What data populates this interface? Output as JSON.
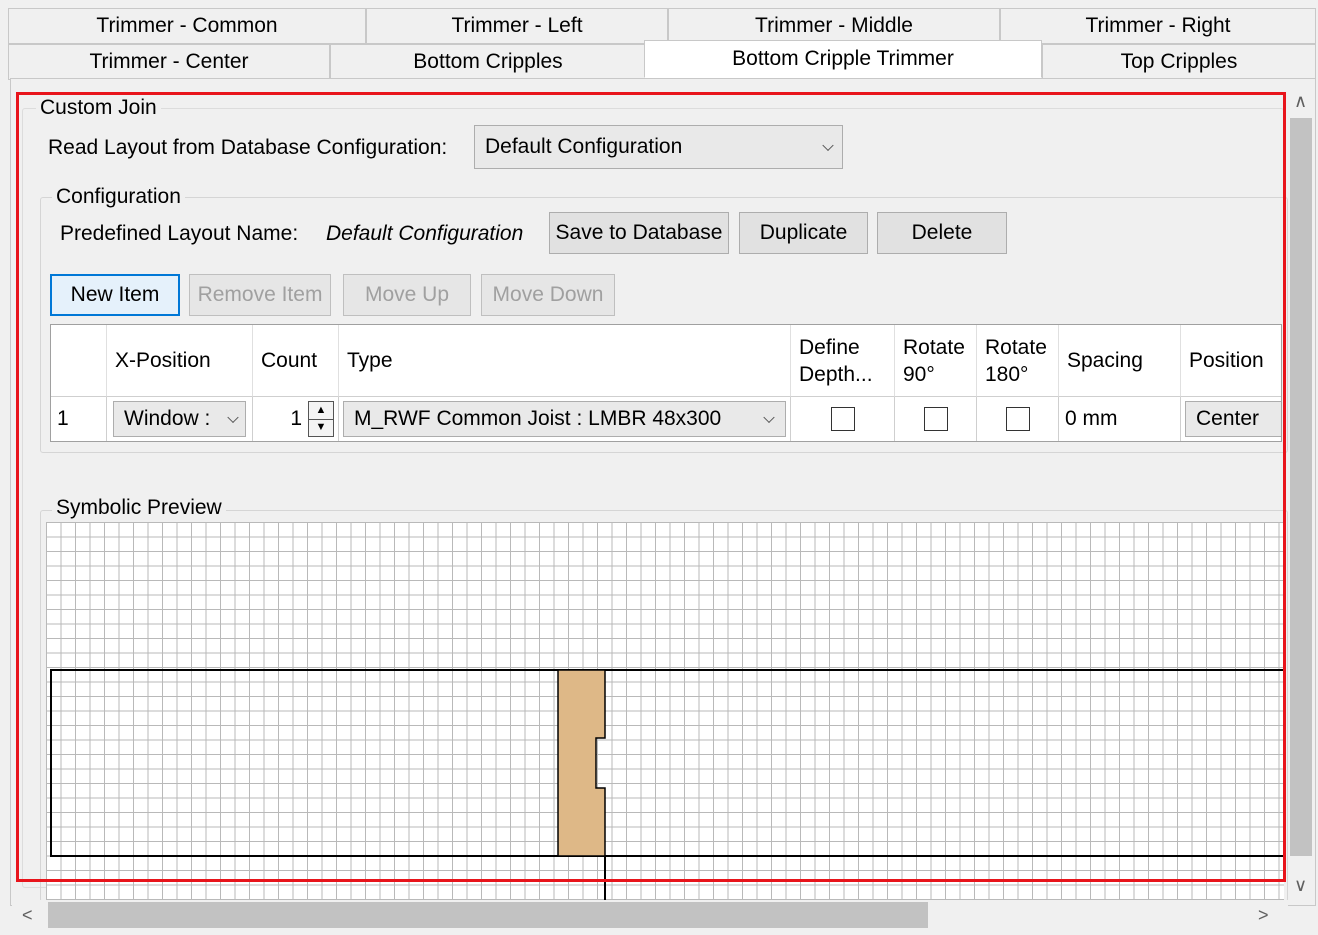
{
  "tabs_row1": [
    "Trimmer - Common",
    "Trimmer - Left",
    "Trimmer - Middle",
    "Trimmer - Right"
  ],
  "tabs_row2": [
    "Trimmer - Center",
    "Bottom Cripples",
    "Bottom Cripple Trimmer",
    "Top Cripples"
  ],
  "active_tab": "Bottom Cripple Trimmer",
  "custom_join": {
    "title": "Custom Join",
    "read_layout_label": "Read Layout from Database Configuration:",
    "read_layout_value": "Default Configuration"
  },
  "configuration": {
    "title": "Configuration",
    "predefined_label": "Predefined Layout Name:",
    "predefined_value": "Default Configuration",
    "save_button": "Save to Database",
    "duplicate_button": "Duplicate",
    "delete_button": "Delete",
    "new_item_button": "New Item",
    "remove_item_button": "Remove Item",
    "move_up_button": "Move Up",
    "move_down_button": "Move Down"
  },
  "table": {
    "headers": {
      "x_position": "X-Position",
      "count": "Count",
      "type": "Type",
      "define_depth_1": "Define",
      "define_depth_2": "Depth...",
      "rotate90_1": "Rotate",
      "rotate90_2": "90°",
      "rotate180_1": "Rotate",
      "rotate180_2": "180°",
      "spacing": "Spacing",
      "position": "Position"
    },
    "row": {
      "index": "1",
      "x_position": "Window :",
      "count": "1",
      "type": "M_RWF Common Joist : LMBR 48x300",
      "define_depth": false,
      "rotate90": false,
      "rotate180": false,
      "spacing": "0 mm",
      "position": "Center"
    }
  },
  "symbolic_preview": {
    "title": "Symbolic Preview",
    "member_color": "#deb887"
  },
  "colors": {
    "highlight": "#e8141b",
    "focus": "#0078d7"
  }
}
